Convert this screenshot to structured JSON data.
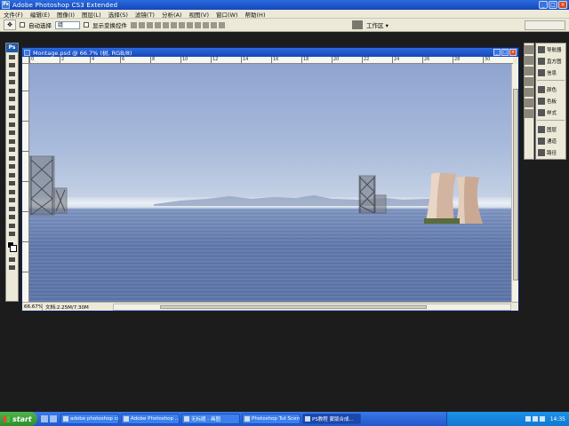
{
  "window": {
    "title": "Adobe Photoshop CS3 Extended"
  },
  "menu": [
    "文件(F)",
    "编辑(E)",
    "图像(I)",
    "图层(L)",
    "选择(S)",
    "滤镜(T)",
    "分析(A)",
    "视图(V)",
    "窗口(W)",
    "帮助(H)"
  ],
  "options": {
    "auto_select_label": "自动选择",
    "auto_select_value": "组",
    "show_transform_label": "显示变换控件",
    "workspace_label": "工作区 ▾"
  },
  "document": {
    "title": "Montage.psd @ 66.7% (树, RGB/8)",
    "zoom": "66.67%",
    "info": "文档:2.25M/7.30M",
    "ruler_ticks": [
      "0",
      "2",
      "4",
      "6",
      "8",
      "10",
      "12",
      "14",
      "16",
      "18",
      "20",
      "22",
      "24",
      "26",
      "28",
      "30"
    ]
  },
  "panels": [
    {
      "icon": "navigator-icon",
      "label": "导航器"
    },
    {
      "icon": "histogram-icon",
      "label": "直方图"
    },
    {
      "icon": "info-icon",
      "label": "信息"
    },
    {
      "icon": "color-icon",
      "label": "颜色"
    },
    {
      "icon": "swatches-icon",
      "label": "色板"
    },
    {
      "icon": "styles-icon",
      "label": "样式"
    },
    {
      "icon": "layers-icon",
      "label": "图层"
    },
    {
      "icon": "channels-icon",
      "label": "通道"
    },
    {
      "icon": "paths-icon",
      "label": "路径"
    }
  ],
  "taskbar": {
    "start": "start",
    "tasks": [
      {
        "label": "adobe photoshop cs...",
        "active": false
      },
      {
        "label": "Adobe Photoshop ...",
        "active": false
      },
      {
        "label": "无标题 - 画图",
        "active": false
      },
      {
        "label": "Photoshop Tut Scene...",
        "active": false
      },
      {
        "label": "PS教程 蒙版合成...",
        "active": true
      }
    ],
    "clock": "14:35"
  }
}
